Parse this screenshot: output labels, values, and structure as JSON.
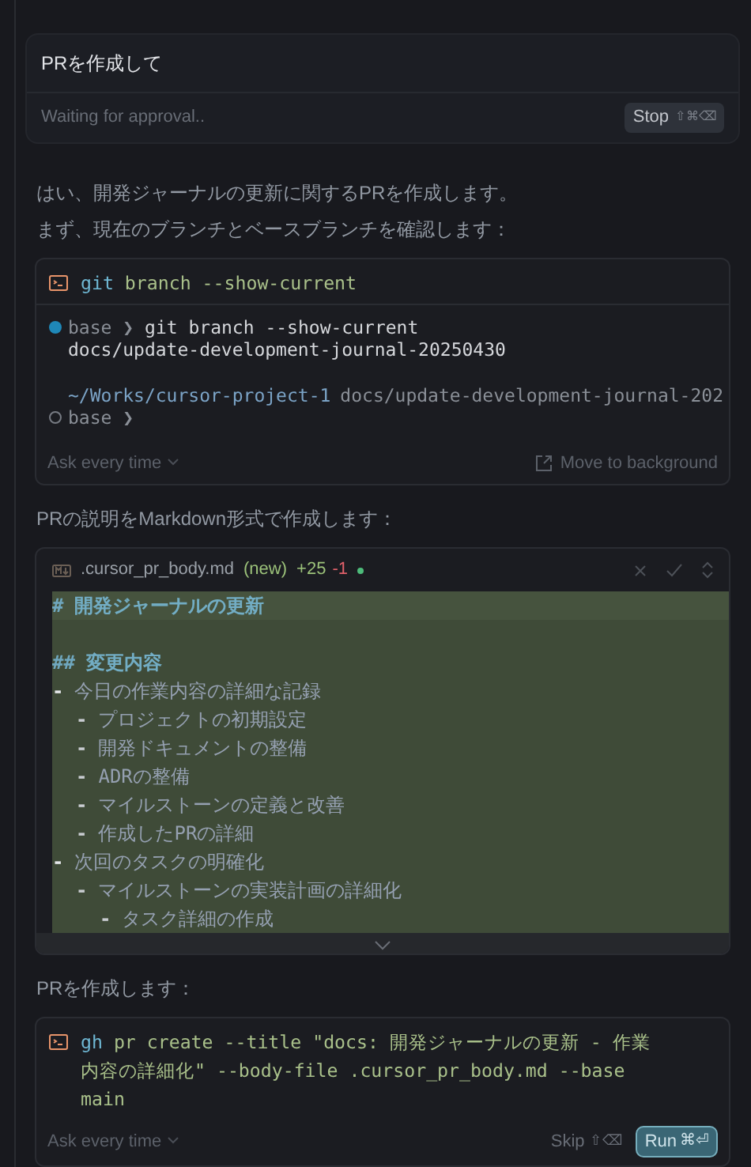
{
  "prompt_card": {
    "title": "PRを作成して",
    "status": "Waiting for approval..",
    "stop_button": {
      "label": "Stop",
      "shortcut": "⇧⌘⌫"
    }
  },
  "items": [
    {
      "kind": "text",
      "lines": [
        "はい、開発ジャーナルの更新に関するPRを作成します。",
        "まず、現在のブランチとベースブランチを確認します："
      ]
    },
    {
      "kind": "terminal",
      "program": "git",
      "args": " branch --show-current",
      "output": [
        {
          "kind": "prompt",
          "active": true,
          "text": "base ❯",
          "command": "git branch --show-current"
        },
        {
          "kind": "output",
          "text": "docs/update-development-journal-20250430"
        },
        {
          "kind": "blank"
        },
        {
          "kind": "path",
          "path": "~/Works/cursor-project-1",
          "branch": "docs/update-development-journal-202"
        },
        {
          "kind": "prompt",
          "active": false,
          "text": "base ❯"
        }
      ],
      "footer": {
        "approval": "Ask every time",
        "actions": [
          {
            "kind": "background",
            "label": "Move to background"
          }
        ]
      }
    },
    {
      "kind": "text",
      "lines": [
        "PRの説明をMarkdown形式で作成します："
      ]
    },
    {
      "kind": "diff",
      "file": ".cursor_pr_body.md",
      "status": "(new)",
      "added": "+25",
      "removed": "-1",
      "lines": [
        {
          "kind": "heading",
          "marker": "#",
          "text": "開発ジャーナルの更新"
        },
        {
          "kind": "blank"
        },
        {
          "kind": "heading",
          "marker": "##",
          "text": "変更内容"
        },
        {
          "kind": "bullet",
          "marker": "-",
          "text": "今日の作業内容の詳細な記録",
          "children": [
            {
              "kind": "bullet",
              "marker": "-",
              "text": "プロジェクトの初期設定"
            },
            {
              "kind": "bullet",
              "marker": "-",
              "text": "開発ドキュメントの整備"
            },
            {
              "kind": "bullet",
              "marker": "-",
              "text": "ADRの整備"
            },
            {
              "kind": "bullet",
              "marker": "-",
              "text": "マイルストーンの定義と改善"
            },
            {
              "kind": "bullet",
              "marker": "-",
              "text": "作成したPRの詳細"
            }
          ]
        },
        {
          "kind": "bullet",
          "marker": "-",
          "text": "次回のタスクの明確化",
          "children": [
            {
              "kind": "bullet",
              "marker": "-",
              "text": "マイルストーンの実装計画の詳細化",
              "children": [
                {
                  "kind": "bullet",
                  "marker": "-",
                  "text": "タスク詳細の作成"
                }
              ]
            }
          ]
        }
      ]
    },
    {
      "kind": "text",
      "lines": [
        "PRを作成します："
      ]
    },
    {
      "kind": "terminal",
      "program": "gh",
      "args": " pr create --title \"docs: 開発ジャーナルの更新 - 作業内容の詳細化\" --body-file .cursor_pr_body.md --base main",
      "footer": {
        "approval": "Ask every time",
        "actions": [
          {
            "kind": "skip",
            "label": "Skip",
            "shortcut": "⇧⌫"
          },
          {
            "kind": "run",
            "label": "Run",
            "shortcut": "⌘⏎"
          }
        ]
      }
    }
  ]
}
